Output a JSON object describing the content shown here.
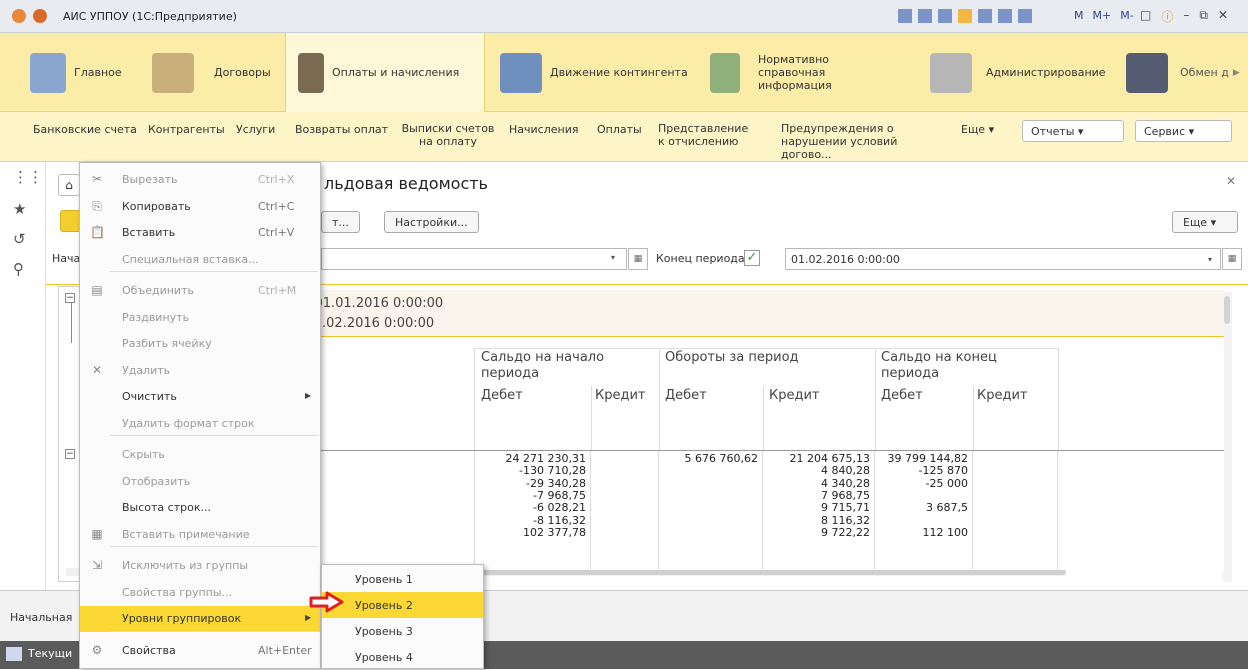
{
  "window": {
    "title": "АИС УППОУ (1С:Предприятие)",
    "controls": [
      "M",
      "M+",
      "M-"
    ]
  },
  "sections": [
    {
      "label": "Главное"
    },
    {
      "label": "Договоры"
    },
    {
      "label": "Оплаты и начисления"
    },
    {
      "label": "Движение контингента"
    },
    {
      "label": "Нормативно справочная информация"
    },
    {
      "label": "Администрирование"
    },
    {
      "label": "Обмен д"
    }
  ],
  "subnav": {
    "items": [
      "Банковские счета",
      "Контрагенты",
      "Услуги",
      "Возвраты оплат",
      "Выписки счетов на оплату",
      "Начисления",
      "Оплаты",
      "Представление к отчислению",
      "Предупреждения о нарушении условий догово..."
    ],
    "more": "Еще",
    "reports": "Отчеты",
    "service": "Сервис"
  },
  "form": {
    "title": "льдовая ведомость",
    "btn_partial": "т...",
    "settings_btn": "Настройки...",
    "more_btn": "Еще",
    "start_label": "Нача",
    "end_period_label": "Конец периода:",
    "end_period_value": "01.02.2016 0:00:00",
    "period_line1": "да: 01.01.2016 0:00:00",
    "period_line2": "а: 01.02.2016 0:00:00"
  },
  "table": {
    "group_headers": [
      "Сальдо на начало периода",
      "Обороты за период",
      "Сальдо на конец периода"
    ],
    "sub_headers": [
      "Дебет",
      "Кредит",
      "Дебет",
      "Кредит",
      "Дебет",
      "Кредит"
    ],
    "rows": [
      [
        "24 271 230,31",
        "",
        "5 676 760,62",
        "21 204 675,13",
        "39 799 144,82",
        ""
      ],
      [
        "-130 710,28",
        "",
        "",
        "4 840,28",
        "-125 870",
        ""
      ],
      [
        "-29 340,28",
        "",
        "",
        "4 340,28",
        "-25 000",
        ""
      ],
      [
        "-7 968,75",
        "",
        "",
        "7 968,75",
        "",
        ""
      ],
      [
        "-6 028,21",
        "",
        "",
        "9 715,71",
        "3 687,5",
        ""
      ],
      [
        "-8 116,32",
        "",
        "",
        "8 116,32",
        "",
        ""
      ],
      [
        "102 377,78",
        "",
        "",
        "9 722,22",
        "112 100",
        ""
      ]
    ]
  },
  "bottom": {
    "tab_label": "Начальная",
    "taskbar_item": "Текущи"
  },
  "context_menu": [
    {
      "label": "Вырезать",
      "shortcut": "Ctrl+X",
      "icon": "scissors-icon",
      "disabled": true
    },
    {
      "label": "Копировать",
      "shortcut": "Ctrl+C",
      "icon": "copy-icon",
      "disabled": false
    },
    {
      "label": "Вставить",
      "shortcut": "Ctrl+V",
      "icon": "paste-icon",
      "disabled": false
    },
    {
      "label": "Специальная вставка...",
      "shortcut": "",
      "icon": "",
      "disabled": true
    },
    {
      "label": "Объединить",
      "shortcut": "Ctrl+M",
      "icon": "merge-icon",
      "disabled": true
    },
    {
      "label": "Раздвинуть",
      "shortcut": "",
      "icon": "",
      "disabled": true
    },
    {
      "label": "Разбить ячейку",
      "shortcut": "",
      "icon": "",
      "disabled": true
    },
    {
      "label": "Удалить",
      "shortcut": "",
      "icon": "delete-icon",
      "disabled": true
    },
    {
      "label": "Очистить",
      "shortcut": "",
      "icon": "",
      "disabled": false
    },
    {
      "label": "Удалить формат строк",
      "shortcut": "",
      "icon": "",
      "disabled": true
    },
    {
      "label": "Скрыть",
      "shortcut": "",
      "icon": "",
      "disabled": true
    },
    {
      "label": "Отобразить",
      "shortcut": "",
      "icon": "",
      "disabled": true
    },
    {
      "label": "Высота строк...",
      "shortcut": "",
      "icon": "",
      "disabled": false
    },
    {
      "label": "Вставить примечание",
      "shortcut": "",
      "icon": "note-icon",
      "disabled": true
    },
    {
      "label": "Исключить из группы",
      "shortcut": "",
      "icon": "ungroup-icon",
      "disabled": true
    },
    {
      "label": "Свойства группы...",
      "shortcut": "",
      "icon": "",
      "disabled": true
    },
    {
      "label": "Уровни группировок",
      "shortcut": "",
      "icon": "",
      "disabled": false
    },
    {
      "label": "Свойства",
      "shortcut": "Alt+Enter",
      "icon": "properties-icon",
      "disabled": false
    }
  ],
  "submenu": [
    "Уровень 1",
    "Уровень 2",
    "Уровень 3",
    "Уровень 4"
  ],
  "colors": {
    "accent_yellow": "#fbeda7",
    "highlight": "#fcd835",
    "arrow": "#e02020"
  }
}
